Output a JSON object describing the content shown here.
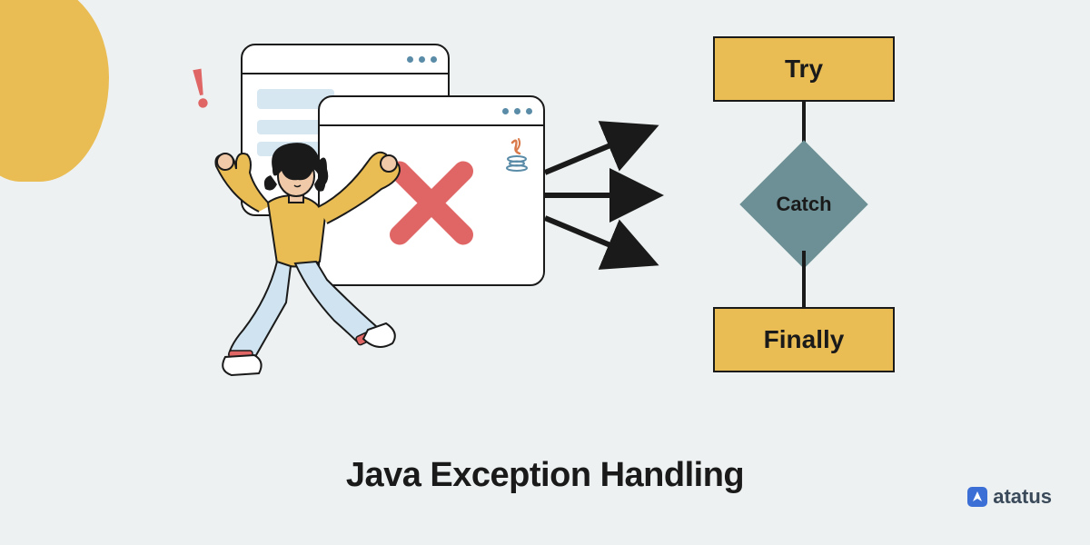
{
  "flowchart": {
    "try": "Try",
    "catch": "Catch",
    "finally": "Finally"
  },
  "title": "Java Exception Handling",
  "brand": "atatus",
  "icons": {
    "exclaim": "!",
    "xmark": "x-mark-icon",
    "java": "java-logo-icon",
    "brand": "brand-logo-icon"
  }
}
